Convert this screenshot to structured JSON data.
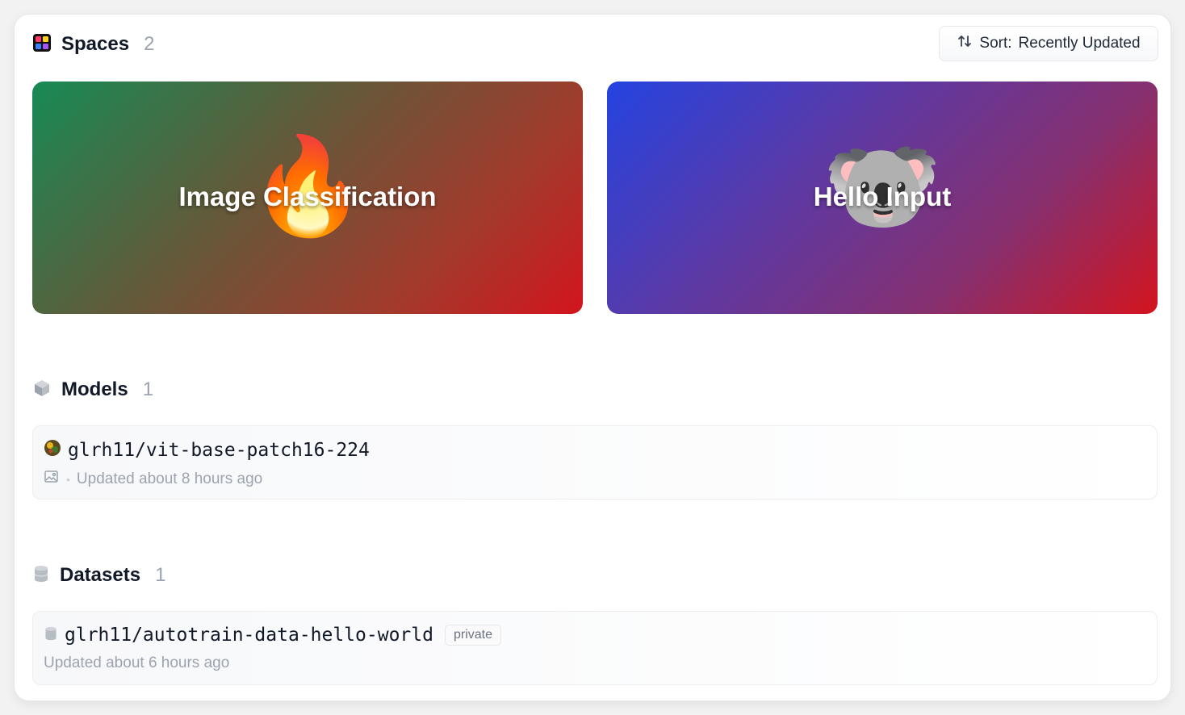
{
  "spaces": {
    "title": "Spaces",
    "count": "2",
    "sort_label": "Sort:",
    "sort_value": "Recently Updated",
    "cards": [
      {
        "title": "Image Classification",
        "emoji": "🔥",
        "icon": "fire-emoji"
      },
      {
        "title": "Hello Input",
        "emoji": "🐨",
        "icon": "koala-emoji"
      }
    ]
  },
  "models": {
    "title": "Models",
    "count": "1",
    "items": [
      {
        "name": "glrh11/vit-base-patch16-224",
        "updated": "Updated about 8 hours ago",
        "task_icon": "image-classification-icon"
      }
    ]
  },
  "datasets": {
    "title": "Datasets",
    "count": "1",
    "items": [
      {
        "name": "glrh11/autotrain-data-hello-world",
        "badge": "private",
        "updated": "Updated about 6 hours ago"
      }
    ]
  }
}
